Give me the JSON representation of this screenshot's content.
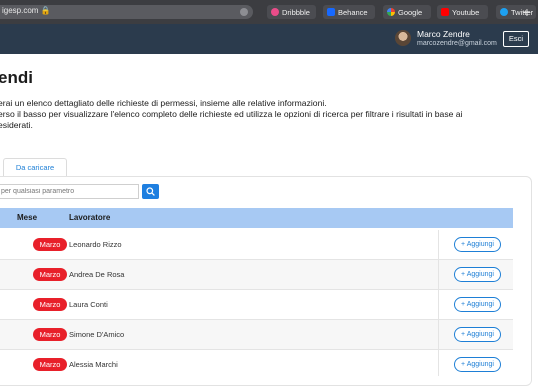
{
  "browser": {
    "url": "igesp.com 🔒",
    "bookmarks": [
      {
        "label": "Dribbble",
        "icon": "dribbble-icon",
        "color": "#ea4c89"
      },
      {
        "label": "Behance",
        "icon": "behance-icon",
        "color": "#1769ff"
      },
      {
        "label": "Google",
        "icon": "google-icon",
        "color": "#34a853"
      },
      {
        "label": "Youtube",
        "icon": "youtube-icon",
        "color": "#ff0000"
      },
      {
        "label": "Twitter",
        "icon": "twitter-icon",
        "color": "#1da1f2"
      }
    ],
    "new_tab": "+"
  },
  "header": {
    "user_name": "Marco Zendre",
    "user_email": "marcozendre@gmail.com",
    "logout_label": "Esci"
  },
  "page": {
    "title": "endi",
    "description_lines": [
      "erai un elenco dettagliato delle richieste di permessi, insieme alle relative informazioni.",
      "erso il basso per visualizzare l'elenco completo delle richieste ed utilizza le opzioni di ricerca per filtrare i risultati in base ai",
      "esiderati."
    ]
  },
  "tabs": [
    {
      "label": "Da caricare",
      "active": true
    }
  ],
  "search": {
    "placeholder": "per qualsiasi parametro"
  },
  "table": {
    "columns": [
      "Mese",
      "Lavoratore"
    ],
    "rows": [
      {
        "month": "Marzo",
        "worker": "Leonardo Rizzo",
        "action": "+ Aggiungi"
      },
      {
        "month": "Marzo",
        "worker": "Andrea De Rosa",
        "action": "+ Aggiungi"
      },
      {
        "month": "Marzo",
        "worker": "Laura Conti",
        "action": "+ Aggiungi"
      },
      {
        "month": "Marzo",
        "worker": "Simone D'Amico",
        "action": "+ Aggiungi"
      },
      {
        "month": "Marzo",
        "worker": "Alessia Marchi",
        "action": "+ Aggiungi"
      }
    ]
  },
  "colors": {
    "header_bg": "#2b3b4d",
    "table_header_bg": "#a7c9f3",
    "badge": "#e8202a",
    "accent": "#1e7fd6"
  }
}
